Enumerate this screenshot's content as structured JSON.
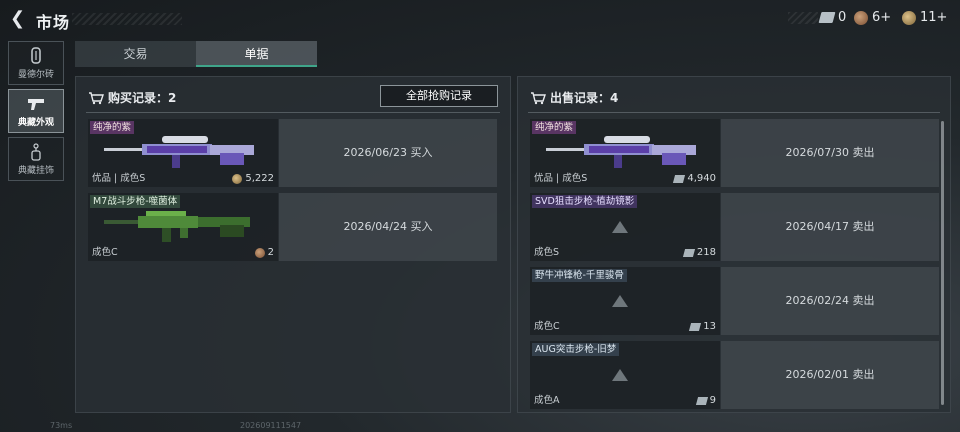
{
  "header": {
    "title": "市场",
    "currencies": [
      {
        "icon": "ticket-icon",
        "value": "0"
      },
      {
        "icon": "brown-coin-icon",
        "value": "6+"
      },
      {
        "icon": "gold-coin-icon",
        "value": "11+"
      }
    ]
  },
  "sidebar": {
    "items": [
      {
        "label": "曼德尔砖",
        "icon": "brick-icon",
        "active": false
      },
      {
        "label": "典藏外观",
        "icon": "pistol-icon",
        "active": true
      },
      {
        "label": "典藏挂饰",
        "icon": "charm-icon",
        "active": false
      }
    ]
  },
  "tabs": [
    {
      "label": "交易",
      "active": false
    },
    {
      "label": "单据",
      "active": true
    }
  ],
  "buy": {
    "title": "购买记录：2",
    "all_button": "全部抢购记录",
    "records": [
      {
        "name": "纯净的紫",
        "grade": "优品 | 成色S",
        "price": "5,222",
        "date": "2026/06/23 买入"
      },
      {
        "name": "M7战斗步枪-噬菌体",
        "grade": "成色C",
        "price": "2",
        "date": "2026/04/24 买入"
      }
    ]
  },
  "sell": {
    "title": "出售记录：4",
    "records": [
      {
        "name": "纯净的紫",
        "grade": "优品 | 成色S",
        "price": "4,940",
        "date": "2026/07/30 卖出"
      },
      {
        "name": "SVD狙击步枪-植劫镜影",
        "grade": "成色S",
        "price": "218",
        "date": "2026/04/17 卖出"
      },
      {
        "name": "野牛冲锋枪-千里骏骨",
        "grade": "成色C",
        "price": "13",
        "date": "2026/02/24 卖出"
      },
      {
        "name": "AUG突击步枪-旧梦",
        "grade": "成色A",
        "price": "9",
        "date": "2026/02/01 卖出"
      }
    ]
  },
  "footer": {
    "ping": "73ms",
    "uid": "202609111547"
  }
}
